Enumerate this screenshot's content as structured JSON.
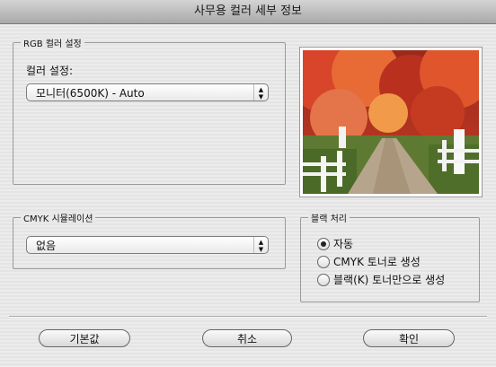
{
  "window": {
    "title": "사무용 컬러 세부 정보"
  },
  "rgb_group": {
    "legend": "RGB 컬러 설정",
    "color_setting_label": "컬러 설정:",
    "color_setting_value": "모니터(6500K) - Auto"
  },
  "cmyk_group": {
    "legend": "CMYK 시뮬레이션",
    "value": "없음"
  },
  "black_group": {
    "legend": "블랙 처리",
    "options": [
      {
        "label": "자동",
        "selected": true
      },
      {
        "label": "CMYK 토너로 생성",
        "selected": false
      },
      {
        "label": "블랙(K) 토너만으로 생성",
        "selected": false
      }
    ]
  },
  "buttons": {
    "defaults": "기본값",
    "cancel": "취소",
    "ok": "확인"
  },
  "icons": {
    "popup_arrows": "up-down-chevrons-icon"
  }
}
